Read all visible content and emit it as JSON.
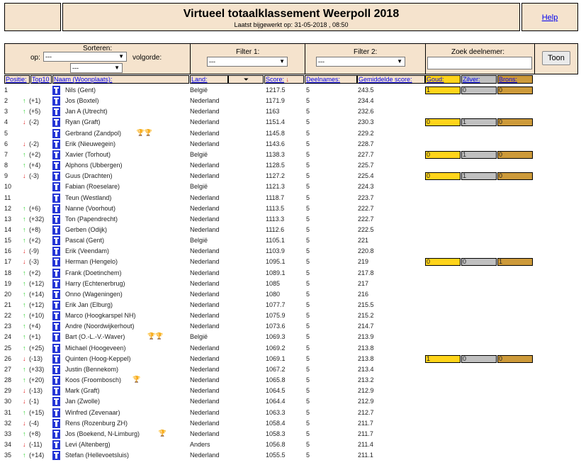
{
  "header": {
    "title": "Virtueel totaalklassement Weerpoll 2018",
    "subtitle": "Laatst bijgewerkt op: 31-05-2018 , 08:50",
    "help_label": "Help"
  },
  "controls": {
    "sort_label": "Sorteren:",
    "on_label": "op:",
    "order_label": "volgorde:",
    "sort_value": "---",
    "order_value": "---",
    "filter1_label": "Filter 1:",
    "filter1_value": "---",
    "filter2_label": "Filter 2:",
    "filter2_value": "---",
    "search_label": "Zoek deelnemer:",
    "search_placeholder": "",
    "show_button": "Toon"
  },
  "columns": {
    "position": "Positie:",
    "top10": "Top10",
    "name": "Naam (Woonplaats):",
    "country": "Land:",
    "score": "Score:",
    "entries": "Deelnames:",
    "avg": "Gemiddelde score:",
    "gold": "Goud:",
    "silver": "Zilver:",
    "bronze": "Brons:"
  },
  "rows": [
    {
      "pos": "1",
      "trend": "",
      "chg": "",
      "name": "Nils (Gent)",
      "country": "België",
      "score": "1217.5",
      "entries": "5",
      "avg": "243.5",
      "medals": [
        "1",
        "0",
        "0"
      ]
    },
    {
      "pos": "2",
      "trend": "up",
      "chg": "(+1)",
      "name": "Jos (Boxtel)",
      "country": "Nederland",
      "score": "1171.9",
      "entries": "5",
      "avg": "234.4"
    },
    {
      "pos": "3",
      "trend": "up",
      "chg": "(+5)",
      "name": "Jan A (Utrecht)",
      "country": "Nederland",
      "score": "1163",
      "entries": "5",
      "avg": "232.6"
    },
    {
      "pos": "4",
      "trend": "down",
      "chg": "(-2)",
      "name": "Ryan (Graft)",
      "country": "Nederland",
      "score": "1151.4",
      "entries": "5",
      "avg": "230.3",
      "medals": [
        "0",
        "1",
        "0"
      ]
    },
    {
      "pos": "5",
      "trend": "",
      "chg": "",
      "name": "Gerbrand (Zandpol)",
      "trophies": "🏆🏆",
      "country": "Nederland",
      "score": "1145.8",
      "entries": "5",
      "avg": "229.2"
    },
    {
      "pos": "6",
      "trend": "down",
      "chg": "(-2)",
      "name": "Erik (Nieuwegein)",
      "country": "Nederland",
      "score": "1143.6",
      "entries": "5",
      "avg": "228.7"
    },
    {
      "pos": "7",
      "trend": "up",
      "chg": "(+2)",
      "name": "Xavier (Torhout)",
      "country": "België",
      "score": "1138.3",
      "entries": "5",
      "avg": "227.7",
      "medals": [
        "0",
        "1",
        "0"
      ]
    },
    {
      "pos": "8",
      "trend": "up",
      "chg": "(+4)",
      "name": "Alphons (Ubbergen)",
      "country": "Nederland",
      "score": "1128.5",
      "entries": "5",
      "avg": "225.7"
    },
    {
      "pos": "9",
      "trend": "down",
      "chg": "(-3)",
      "name": "Guus (Drachten)",
      "country": "Nederland",
      "score": "1127.2",
      "entries": "5",
      "avg": "225.4",
      "medals": [
        "0",
        "1",
        "0"
      ]
    },
    {
      "pos": "10",
      "trend": "",
      "chg": "",
      "name": "Fabian (Roeselare)",
      "country": "België",
      "score": "1121.3",
      "entries": "5",
      "avg": "224.3"
    },
    {
      "pos": "11",
      "trend": "",
      "chg": "",
      "name": "Teun (Westland)",
      "country": "Nederland",
      "score": "1118.7",
      "entries": "5",
      "avg": "223.7"
    },
    {
      "pos": "12",
      "trend": "up",
      "chg": "(+6)",
      "name": "Nanne (Voorhout)",
      "country": "Nederland",
      "score": "1113.5",
      "entries": "5",
      "avg": "222.7"
    },
    {
      "pos": "13",
      "trend": "up",
      "chg": "(+32)",
      "name": "Ton (Papendrecht)",
      "country": "Nederland",
      "score": "1113.3",
      "entries": "5",
      "avg": "222.7"
    },
    {
      "pos": "14",
      "trend": "up",
      "chg": "(+8)",
      "name": "Gerben (Odijk)",
      "country": "Nederland",
      "score": "1112.6",
      "entries": "5",
      "avg": "222.5"
    },
    {
      "pos": "15",
      "trend": "up",
      "chg": "(+2)",
      "name": "Pascal (Gent)",
      "country": "België",
      "score": "1105.1",
      "entries": "5",
      "avg": "221"
    },
    {
      "pos": "16",
      "trend": "down",
      "chg": "(-9)",
      "name": "Erik (Veendam)",
      "country": "Nederland",
      "score": "1103.9",
      "entries": "5",
      "avg": "220.8"
    },
    {
      "pos": "17",
      "trend": "down",
      "chg": "(-3)",
      "name": "Herman (Hengelo)",
      "country": "Nederland",
      "score": "1095.1",
      "entries": "5",
      "avg": "219",
      "medals": [
        "0",
        "0",
        "1"
      ]
    },
    {
      "pos": "18",
      "trend": "up",
      "chg": "(+2)",
      "name": "Frank (Doetinchem)",
      "country": "Nederland",
      "score": "1089.1",
      "entries": "5",
      "avg": "217.8"
    },
    {
      "pos": "19",
      "trend": "up",
      "chg": "(+12)",
      "name": "Harry (Echtenerbrug)",
      "country": "Nederland",
      "score": "1085",
      "entries": "5",
      "avg": "217"
    },
    {
      "pos": "20",
      "trend": "up",
      "chg": "(+14)",
      "name": "Onno (Wageningen)",
      "country": "Nederland",
      "score": "1080",
      "entries": "5",
      "avg": "216"
    },
    {
      "pos": "21",
      "trend": "up",
      "chg": "(+12)",
      "name": "Erik Jan (Elburg)",
      "country": "Nederland",
      "score": "1077.7",
      "entries": "5",
      "avg": "215.5"
    },
    {
      "pos": "22",
      "trend": "up",
      "chg": "(+10)",
      "name": "Marco (Hoogkarspel NH)",
      "country": "Nederland",
      "score": "1075.9",
      "entries": "5",
      "avg": "215.2"
    },
    {
      "pos": "23",
      "trend": "up",
      "chg": "(+4)",
      "name": "Andre (Noordwijkerhout)",
      "country": "Nederland",
      "score": "1073.6",
      "entries": "5",
      "avg": "214.7"
    },
    {
      "pos": "24",
      "trend": "up",
      "chg": "(+1)",
      "name": "Bart (O.-L.-V.-Waver)",
      "trophies": "🏆🏆",
      "country": "België",
      "score": "1069.3",
      "entries": "5",
      "avg": "213.9"
    },
    {
      "pos": "25",
      "trend": "up",
      "chg": "(+25)",
      "name": "Michael (Hoogeveen)",
      "country": "Nederland",
      "score": "1069.2",
      "entries": "5",
      "avg": "213.8"
    },
    {
      "pos": "26",
      "trend": "down",
      "chg": "(-13)",
      "name": "Quinten (Hoog-Keppel)",
      "country": "Nederland",
      "score": "1069.1",
      "entries": "5",
      "avg": "213.8",
      "medals": [
        "1",
        "0",
        "0"
      ]
    },
    {
      "pos": "27",
      "trend": "up",
      "chg": "(+33)",
      "name": "Justin (Bennekom)",
      "country": "Nederland",
      "score": "1067.2",
      "entries": "5",
      "avg": "213.4"
    },
    {
      "pos": "28",
      "trend": "up",
      "chg": "(+20)",
      "name": "Koos (Froombosch)",
      "trophies": "🏆",
      "country": "Nederland",
      "score": "1065.8",
      "entries": "5",
      "avg": "213.2"
    },
    {
      "pos": "29",
      "trend": "down",
      "chg": "(-13)",
      "name": "Mark (Graft)",
      "country": "Nederland",
      "score": "1064.5",
      "entries": "5",
      "avg": "212.9"
    },
    {
      "pos": "30",
      "trend": "down",
      "chg": "(-1)",
      "name": "Jan (Zwolle)",
      "country": "Nederland",
      "score": "1064.4",
      "entries": "5",
      "avg": "212.9"
    },
    {
      "pos": "31",
      "trend": "up",
      "chg": "(+15)",
      "name": "Winfred (Zevenaar)",
      "country": "Nederland",
      "score": "1063.3",
      "entries": "5",
      "avg": "212.7"
    },
    {
      "pos": "32",
      "trend": "down",
      "chg": "(-4)",
      "name": "Rens (Rozenburg ZH)",
      "country": "Nederland",
      "score": "1058.4",
      "entries": "5",
      "avg": "211.7"
    },
    {
      "pos": "33",
      "trend": "up",
      "chg": "(+8)",
      "name": "Jos (Boekend, N-Limburg)",
      "trophies": "🏆",
      "country": "Nederland",
      "score": "1058.3",
      "entries": "5",
      "avg": "211.7"
    },
    {
      "pos": "34",
      "trend": "down",
      "chg": "(-11)",
      "name": "Levi (Altenberg)",
      "country": "Anders",
      "score": "1056.8",
      "entries": "5",
      "avg": "211.4"
    },
    {
      "pos": "35",
      "trend": "up",
      "chg": "(+14)",
      "name": "Stefan (Hellevoetsluis)",
      "country": "Nederland",
      "score": "1055.5",
      "entries": "5",
      "avg": "211.1"
    }
  ]
}
